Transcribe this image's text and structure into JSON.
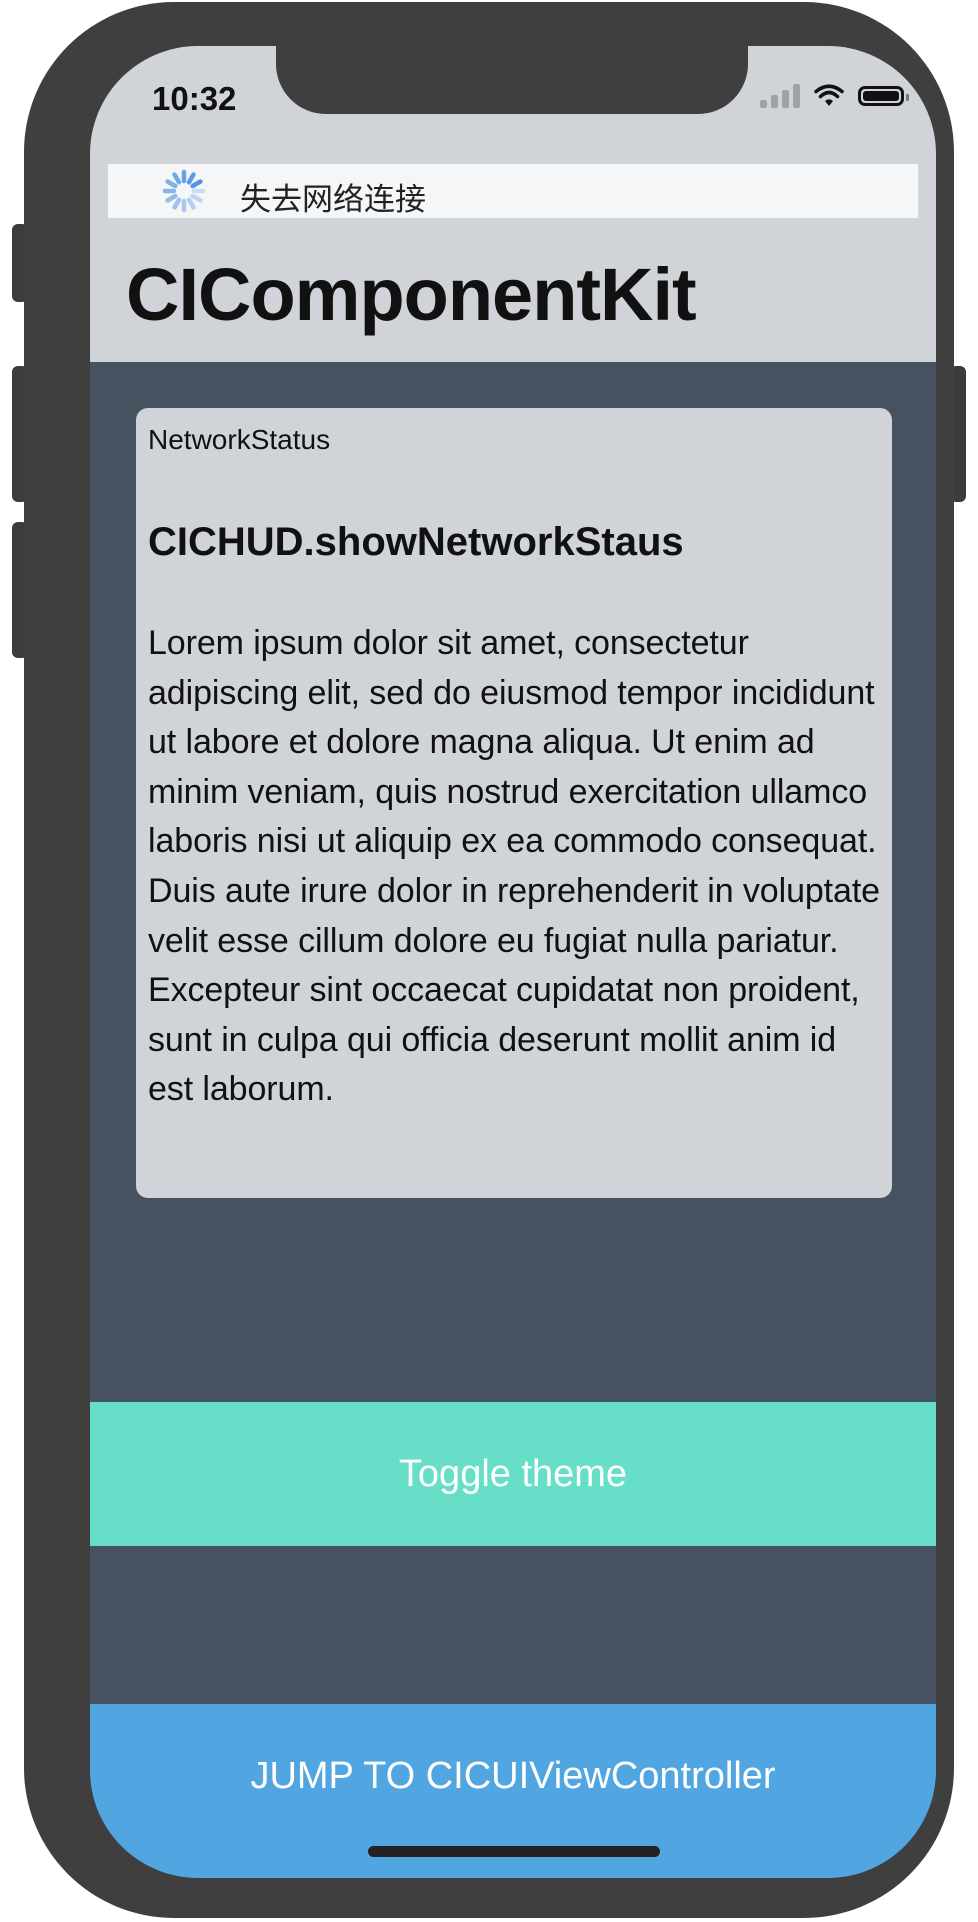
{
  "status_bar": {
    "time": "10:32"
  },
  "network_banner": {
    "message": "失去网络连接"
  },
  "header": {
    "title": "CIComponentKit"
  },
  "card": {
    "tag": "NetworkStatus",
    "title": "CICHUD.showNetworkStaus",
    "body": "Lorem ipsum dolor sit amet, consectetur adipiscing elit, sed do eiusmod tempor incididunt ut labore et dolore magna aliqua. Ut enim ad minim veniam, quis nostrud exercitation ullamco laboris nisi ut aliquip ex ea commodo consequat. Duis aute irure dolor in reprehenderit in voluptate velit esse cillum dolore eu fugiat nulla pariatur. Excepteur sint occaecat cupidatat non proident, sunt in culpa qui officia deserunt mollit anim id est laborum."
  },
  "buttons": {
    "toggle_theme": "Toggle theme",
    "jump": "JUMP TO CICUIViewController"
  },
  "colors": {
    "content_background": "#475261",
    "header_background": "#d0d4d9",
    "toggle_button": "#67dfc8",
    "jump_button": "#51a6e2",
    "spinner": "#4a90e2"
  }
}
